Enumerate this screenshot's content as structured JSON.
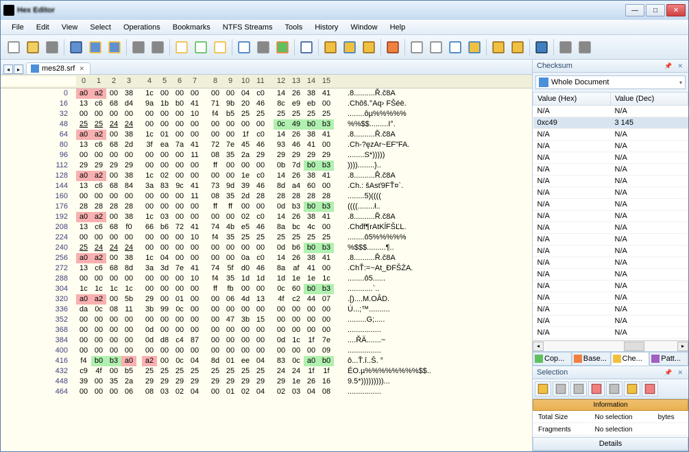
{
  "title": "Hex Editor",
  "menu": [
    "File",
    "Edit",
    "View",
    "Select",
    "Operations",
    "Bookmarks",
    "NTFS Streams",
    "Tools",
    "History",
    "Window",
    "Help"
  ],
  "tab": {
    "name": "mes28.srf"
  },
  "offsets_header": [
    "0",
    "1",
    "2",
    "3",
    "4",
    "5",
    "6",
    "7",
    "8",
    "9",
    "10",
    "11",
    "12",
    "13",
    "14",
    "15"
  ],
  "rows": [
    {
      "off": "0",
      "b": [
        "a0",
        "a2",
        "00",
        "38",
        "1c",
        "00",
        "00",
        "00",
        "00",
        "00",
        "04",
        "c0",
        "14",
        "26",
        "38",
        "41"
      ],
      "a": ".8..........Ř.č8A",
      "hl": {
        "0": "pink",
        "1": "pink"
      }
    },
    {
      "off": "16",
      "b": [
        "13",
        "c6",
        "68",
        "d4",
        "9a",
        "1b",
        "b0",
        "41",
        "71",
        "9b",
        "20",
        "46",
        "8c",
        "e9",
        "eb",
        "00"
      ],
      "a": ".Chôš.°Aq› FŠéë."
    },
    {
      "off": "32",
      "b": [
        "00",
        "00",
        "00",
        "00",
        "00",
        "00",
        "00",
        "10",
        "f4",
        "b5",
        "25",
        "25",
        "25",
        "25",
        "25",
        "25"
      ],
      "a": "........ôµ%%%%%"
    },
    {
      "off": "48",
      "b": [
        "25",
        "25",
        "24",
        "24",
        "00",
        "00",
        "00",
        "00",
        "00",
        "00",
        "00",
        "00",
        "0c",
        "49",
        "b0",
        "b3"
      ],
      "a": "%%$$.........I°.",
      "hl": {
        "12": "green",
        "13": "green",
        "14": "green",
        "15": "green"
      },
      "ul": [
        0,
        1,
        2,
        3
      ]
    },
    {
      "off": "64",
      "b": [
        "a0",
        "a2",
        "00",
        "38",
        "1c",
        "01",
        "00",
        "00",
        "00",
        "00",
        "1f",
        "c0",
        "14",
        "26",
        "38",
        "41"
      ],
      "a": ".8..........Ř.č8A",
      "hl": {
        "0": "pink",
        "1": "pink"
      }
    },
    {
      "off": "80",
      "b": [
        "13",
        "c6",
        "68",
        "2d",
        "3f",
        "ea",
        "7a",
        "41",
        "72",
        "7e",
        "45",
        "46",
        "93",
        "46",
        "41",
        "00"
      ],
      "a": ".Ch-?ęzAr~EF\"FA."
    },
    {
      "off": "96",
      "b": [
        "00",
        "00",
        "00",
        "00",
        "00",
        "00",
        "00",
        "11",
        "08",
        "35",
        "2a",
        "29",
        "29",
        "29",
        "29",
        "29"
      ],
      "a": "........S*)))))"
    },
    {
      "off": "112",
      "b": [
        "29",
        "29",
        "29",
        "29",
        "00",
        "00",
        "00",
        "00",
        "ff",
        "00",
        "00",
        "00",
        "0b",
        "7d",
        "b0",
        "b3"
      ],
      "a": "))))........}..",
      "hl": {
        "14": "green",
        "15": "green"
      }
    },
    {
      "off": "128",
      "b": [
        "a0",
        "a2",
        "00",
        "38",
        "1c",
        "02",
        "00",
        "00",
        "00",
        "00",
        "1e",
        "c0",
        "14",
        "26",
        "38",
        "41"
      ],
      "a": ".8..........Ř.č8A",
      "hl": {
        "0": "pink",
        "1": "pink"
      }
    },
    {
      "off": "144",
      "b": [
        "13",
        "c6",
        "68",
        "84",
        "3a",
        "83",
        "9c",
        "41",
        "73",
        "9d",
        "39",
        "46",
        "8d",
        "a4",
        "60",
        "00"
      ],
      "a": ".Ch.: šAsť9FŤ¤`."
    },
    {
      "off": "160",
      "b": [
        "00",
        "00",
        "00",
        "00",
        "00",
        "00",
        "00",
        "11",
        "08",
        "35",
        "2d",
        "28",
        "28",
        "28",
        "28",
        "28"
      ],
      "a": "........5)(((("
    },
    {
      "off": "176",
      "b": [
        "28",
        "28",
        "28",
        "28",
        "00",
        "00",
        "00",
        "00",
        "ff",
        "ff",
        "00",
        "00",
        "0d",
        "b3",
        "b0",
        "b3"
      ],
      "a": "((((........ł..",
      "hl": {
        "14": "green",
        "15": "green"
      }
    },
    {
      "off": "192",
      "b": [
        "a0",
        "a2",
        "00",
        "38",
        "1c",
        "03",
        "00",
        "00",
        "00",
        "00",
        "02",
        "c0",
        "14",
        "26",
        "38",
        "41"
      ],
      "a": ".8..........Ř.č8A",
      "hl": {
        "0": "pink",
        "1": "pink"
      }
    },
    {
      "off": "208",
      "b": [
        "13",
        "c6",
        "68",
        "f0",
        "66",
        "b6",
        "72",
        "41",
        "74",
        "4b",
        "e5",
        "46",
        "8a",
        "bc",
        "4c",
        "00"
      ],
      "a": ".Chđf¶rAtKĺFŠĽL."
    },
    {
      "off": "224",
      "b": [
        "00",
        "00",
        "00",
        "00",
        "00",
        "00",
        "00",
        "10",
        "f4",
        "35",
        "25",
        "25",
        "25",
        "25",
        "25",
        "25"
      ],
      "a": "........ô5%%%%%"
    },
    {
      "off": "240",
      "b": [
        "25",
        "24",
        "24",
        "24",
        "00",
        "00",
        "00",
        "00",
        "00",
        "00",
        "00",
        "00",
        "0d",
        "b6",
        "b0",
        "b3"
      ],
      "a": "%$$$.........¶..",
      "hl": {
        "14": "green",
        "15": "green"
      },
      "ul": [
        0,
        1,
        2,
        3
      ]
    },
    {
      "off": "256",
      "b": [
        "a0",
        "a2",
        "00",
        "38",
        "1c",
        "04",
        "00",
        "00",
        "00",
        "00",
        "0a",
        "c0",
        "14",
        "26",
        "38",
        "41"
      ],
      "a": ".8..........Ř.č8A",
      "hl": {
        "0": "pink",
        "1": "pink"
      }
    },
    {
      "off": "272",
      "b": [
        "13",
        "c6",
        "68",
        "8d",
        "3a",
        "3d",
        "7e",
        "41",
        "74",
        "5f",
        "d0",
        "46",
        "8a",
        "af",
        "41",
        "00"
      ],
      "a": ".ChŤ:=~At_ĐFŠŻA."
    },
    {
      "off": "288",
      "b": [
        "00",
        "00",
        "00",
        "00",
        "00",
        "00",
        "00",
        "10",
        "f4",
        "35",
        "1d",
        "1d",
        "1d",
        "1e",
        "1e",
        "1c"
      ],
      "a": "........ô5......"
    },
    {
      "off": "304",
      "b": [
        "1c",
        "1c",
        "1c",
        "1c",
        "00",
        "00",
        "00",
        "00",
        "ff",
        "fb",
        "00",
        "00",
        "0c",
        "60",
        "b0",
        "b3"
      ],
      "a": "............`..",
      "hl": {
        "14": "green",
        "15": "green"
      }
    },
    {
      "off": "320",
      "b": [
        "a0",
        "a2",
        "00",
        "5b",
        "29",
        "00",
        "01",
        "00",
        "00",
        "06",
        "4d",
        "13",
        "4f",
        "c2",
        "44",
        "07"
      ],
      "a": ".[)....M.OÂD.",
      "hl": {
        "0": "pink",
        "1": "pink"
      }
    },
    {
      "off": "336",
      "b": [
        "da",
        "0c",
        "08",
        "11",
        "3b",
        "99",
        "0c",
        "00",
        "00",
        "00",
        "00",
        "00",
        "00",
        "00",
        "00",
        "00"
      ],
      "a": "Ú...;™.........."
    },
    {
      "off": "352",
      "b": [
        "00",
        "00",
        "00",
        "00",
        "00",
        "00",
        "00",
        "00",
        "00",
        "47",
        "3b",
        "15",
        "00",
        "00",
        "00",
        "00"
      ],
      "a": ".........G;....."
    },
    {
      "off": "368",
      "b": [
        "00",
        "00",
        "00",
        "00",
        "0d",
        "00",
        "00",
        "00",
        "00",
        "00",
        "00",
        "00",
        "00",
        "00",
        "00",
        "00"
      ],
      "a": "................"
    },
    {
      "off": "384",
      "b": [
        "00",
        "00",
        "00",
        "00",
        "0d",
        "d8",
        "c4",
        "87",
        "00",
        "00",
        "00",
        "00",
        "0d",
        "1c",
        "1f",
        "7e"
      ],
      "a": "....ŘÄ.......~"
    },
    {
      "off": "400",
      "b": [
        "00",
        "00",
        "00",
        "00",
        "00",
        "00",
        "00",
        "00",
        "00",
        "00",
        "00",
        "00",
        "00",
        "00",
        "00",
        "09"
      ],
      "a": "................"
    },
    {
      "off": "416",
      "b": [
        "f4",
        "b0",
        "b3",
        "a0",
        "a2",
        "00",
        "0c",
        "04",
        "8d",
        "01",
        "ee",
        "04",
        "83",
        "0c",
        "a0",
        "b0"
      ],
      "a": "ô...Ť.î..Š. °",
      "hl": {
        "1": "green",
        "2": "green",
        "3": "pink",
        "4": "pink",
        "14": "green",
        "15": "green"
      }
    },
    {
      "off": "432",
      "b": [
        "c9",
        "4f",
        "00",
        "b5",
        "25",
        "25",
        "25",
        "25",
        "25",
        "25",
        "25",
        "25",
        "24",
        "24",
        "1f",
        "1f"
      ],
      "a": "ÉO.µ%%%%%%%%$$.."
    },
    {
      "off": "448",
      "b": [
        "39",
        "00",
        "35",
        "2a",
        "29",
        "29",
        "29",
        "29",
        "29",
        "29",
        "29",
        "29",
        "29",
        "1e",
        "26",
        "16"
      ],
      "a": "9.5*)))))))))..."
    },
    {
      "off": "464",
      "b": [
        "00",
        "00",
        "00",
        "06",
        "08",
        "03",
        "02",
        "04",
        "00",
        "01",
        "02",
        "04",
        "02",
        "03",
        "04",
        "08"
      ],
      "a": "................"
    }
  ],
  "checksum": {
    "title": "Checksum",
    "scope": "Whole Document",
    "cols": [
      "Value (Hex)",
      "Value (Dec)"
    ],
    "rows": [
      [
        "N/A",
        "N/A"
      ],
      [
        "0xc49",
        "3 145"
      ],
      [
        "N/A",
        "N/A"
      ],
      [
        "N/A",
        "N/A"
      ],
      [
        "N/A",
        "N/A"
      ],
      [
        "N/A",
        "N/A"
      ],
      [
        "N/A",
        "N/A"
      ],
      [
        "N/A",
        "N/A"
      ],
      [
        "N/A",
        "N/A"
      ],
      [
        "N/A",
        "N/A"
      ],
      [
        "N/A",
        "N/A"
      ],
      [
        "N/A",
        "N/A"
      ],
      [
        "N/A",
        "N/A"
      ],
      [
        "N/A",
        "N/A"
      ],
      [
        "N/A",
        "N/A"
      ],
      [
        "N/A",
        "N/A"
      ],
      [
        "N/A",
        "N/A"
      ],
      [
        "N/A",
        "N/A"
      ],
      [
        "N/A",
        "N/A"
      ],
      [
        "N/A",
        "N/A"
      ]
    ],
    "selected": 1,
    "tabs": [
      "Cop...",
      "Base...",
      "Che...",
      "Patt..."
    ]
  },
  "selection": {
    "title": "Selection",
    "info_hdr": "Information",
    "rows": [
      [
        "Total Size",
        "No selection",
        "bytes"
      ],
      [
        "Fragments",
        "No selection",
        ""
      ]
    ],
    "details": "Details"
  }
}
